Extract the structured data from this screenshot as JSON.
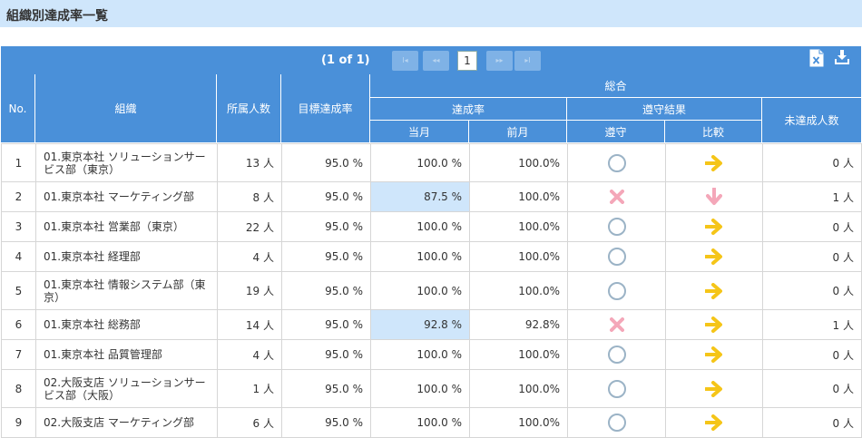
{
  "page_title": "組織別達成率一覧",
  "pager": {
    "page_info": "(1 of 1)",
    "first_label": "I◂",
    "prev_label": "◂◂",
    "current_page": "1",
    "next_label": "▸▸",
    "last_label": "▸I"
  },
  "icons": {
    "export": "excel-export-icon",
    "download": "download-icon"
  },
  "colors": {
    "header_bg": "#4a90d9",
    "title_bg": "#cfe6fb",
    "highlight": "#cfe6fb",
    "arrow_right": "#f5c518",
    "arrow_down": "#f4a7b9",
    "cross": "#f4a7b9",
    "circle": "#9bb3c6"
  },
  "headers": {
    "no": "No.",
    "org": "組織",
    "members": "所属人数",
    "target": "目標達成率",
    "overall": "総合",
    "rate": "達成率",
    "current": "当月",
    "previous": "前月",
    "compliance_result": "遵守結果",
    "compliance": "遵守",
    "comparison": "比較",
    "not_achieved": "未達成人数"
  },
  "rows": [
    {
      "no": "1",
      "org": "01.東京本社 ソリューションサービス部（東京）",
      "members": "13 人",
      "target": "95.0 %",
      "current": "100.0 %",
      "previous": "100.0%",
      "compliance": "ok",
      "comparison": "right",
      "not_achieved": "0 人",
      "highlight": false
    },
    {
      "no": "2",
      "org": "01.東京本社 マーケティング部",
      "members": "8 人",
      "target": "95.0 %",
      "current": "87.5 %",
      "previous": "100.0%",
      "compliance": "ng",
      "comparison": "down",
      "not_achieved": "1 人",
      "highlight": true
    },
    {
      "no": "3",
      "org": "01.東京本社 営業部（東京）",
      "members": "22 人",
      "target": "95.0 %",
      "current": "100.0 %",
      "previous": "100.0%",
      "compliance": "ok",
      "comparison": "right",
      "not_achieved": "0 人",
      "highlight": false
    },
    {
      "no": "4",
      "org": "01.東京本社 経理部",
      "members": "4 人",
      "target": "95.0 %",
      "current": "100.0 %",
      "previous": "100.0%",
      "compliance": "ok",
      "comparison": "right",
      "not_achieved": "0 人",
      "highlight": false
    },
    {
      "no": "5",
      "org": "01.東京本社 情報システム部（東京）",
      "members": "19 人",
      "target": "95.0 %",
      "current": "100.0 %",
      "previous": "100.0%",
      "compliance": "ok",
      "comparison": "right",
      "not_achieved": "0 人",
      "highlight": false
    },
    {
      "no": "6",
      "org": "01.東京本社 総務部",
      "members": "14 人",
      "target": "95.0 %",
      "current": "92.8 %",
      "previous": "92.8%",
      "compliance": "ng",
      "comparison": "right",
      "not_achieved": "1 人",
      "highlight": true
    },
    {
      "no": "7",
      "org": "01.東京本社 品質管理部",
      "members": "4 人",
      "target": "95.0 %",
      "current": "100.0 %",
      "previous": "100.0%",
      "compliance": "ok",
      "comparison": "right",
      "not_achieved": "0 人",
      "highlight": false
    },
    {
      "no": "8",
      "org": "02.大阪支店 ソリューションサービス部（大阪）",
      "members": "1 人",
      "target": "95.0 %",
      "current": "100.0 %",
      "previous": "100.0%",
      "compliance": "ok",
      "comparison": "right",
      "not_achieved": "0 人",
      "highlight": false
    },
    {
      "no": "9",
      "org": "02.大阪支店 マーケティング部",
      "members": "6 人",
      "target": "95.0 %",
      "current": "100.0 %",
      "previous": "100.0%",
      "compliance": "ok",
      "comparison": "right",
      "not_achieved": "0 人",
      "highlight": false
    }
  ]
}
